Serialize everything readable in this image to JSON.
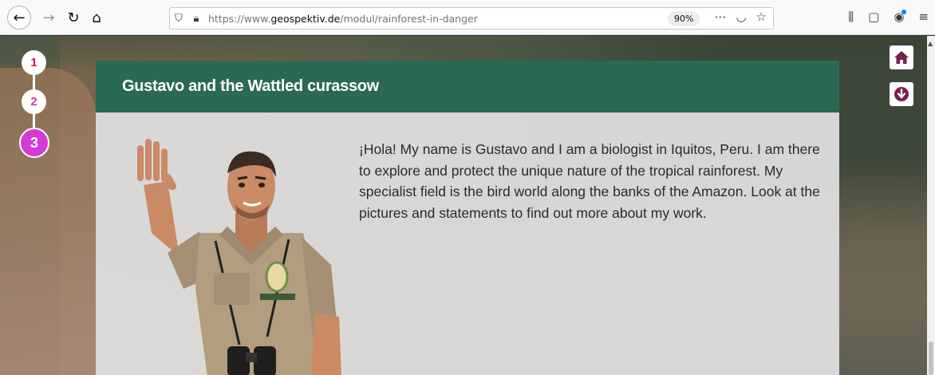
{
  "browser": {
    "url_prefix": "https://www.",
    "url_domain": "geospektiv.de",
    "url_path": "/modul/rainforest-in-danger",
    "zoom": "90%"
  },
  "steps": [
    "1",
    "2",
    "3"
  ],
  "card": {
    "title": "Gustavo and the Wattled curassow",
    "text": "¡Hola! My name is Gustavo and I am a biologist in Iquitos, Peru. I am there to explore and protect the unique nature of the tropical rainforest. My specialist field is the bird world along the banks of the Amazon. Look at the pictures and statements to find out more about my work."
  },
  "icons": {
    "home": "home-icon",
    "down": "arrow-down-circle-icon"
  },
  "colors": {
    "header": "#2a6a52",
    "step1": "#d0133b",
    "step2": "#d33a9e",
    "step3": "#d43ad6"
  }
}
